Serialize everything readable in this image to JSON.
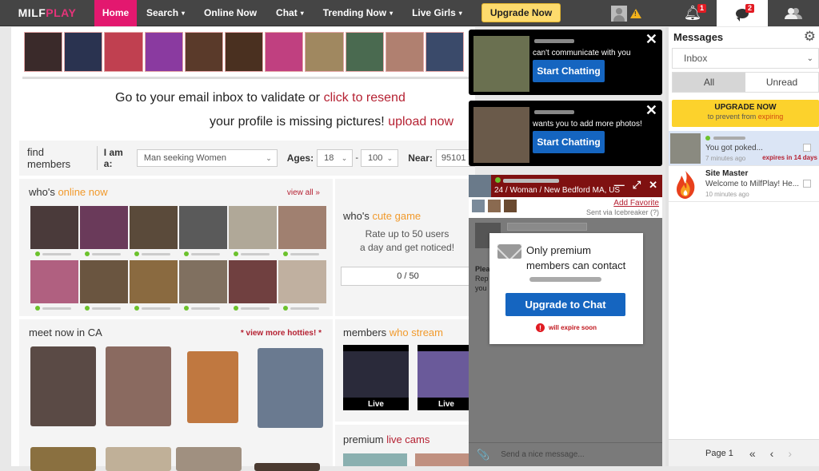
{
  "nav": {
    "logo_part1": "MILF",
    "logo_part2": "PLAY",
    "items": [
      {
        "label": "Home",
        "active": true,
        "dropdown": false
      },
      {
        "label": "Search",
        "dropdown": true
      },
      {
        "label": "Online Now",
        "dropdown": false
      },
      {
        "label": "Chat",
        "dropdown": true
      },
      {
        "label": "Trending Now",
        "dropdown": true
      },
      {
        "label": "Live Girls",
        "dropdown": true
      }
    ],
    "upgrade_label": "Upgrade Now",
    "warning_icon": "!",
    "notifications_count": "1",
    "messages_count": "2",
    "dropdown_caret": "▾"
  },
  "notices": {
    "validate_text": "Go to your email inbox to validate or ",
    "validate_link": "click to resend",
    "pictures_text": "your profile is missing pictures! ",
    "pictures_link": "upload now"
  },
  "search": {
    "title": "find members",
    "iam_label": "I am a:",
    "iam_value": "Man seeking Women",
    "ages_label": "Ages:",
    "age_min": "18",
    "age_sep": "-",
    "age_max": "100",
    "near_label": "Near:",
    "near_value": "95101",
    "chev": "⌄"
  },
  "online_now": {
    "title_prefix": "who's ",
    "title_highlight": "online now",
    "link": "view all »",
    "colors": [
      "#4a3a3a",
      "#6a3a5a",
      "#5a4a3a",
      "#5a5a5a",
      "#b0a898",
      "#a08070",
      "#b06080",
      "#6a5540",
      "#8a6a40",
      "#807060",
      "#704040",
      "#c0b0a0"
    ]
  },
  "cute_game": {
    "title_prefix": "who's ",
    "title_highlight": "cute game",
    "line1": "Rate up to 50 users",
    "line2": "a day and get noticed!",
    "count": "0 / 50"
  },
  "meet_now": {
    "title": "meet now in CA",
    "link": "* view more hotties! *"
  },
  "streams": {
    "title_prefix": "members ",
    "title_highlight": "who stream",
    "live_label": "Live"
  },
  "premium_cams": {
    "title_prefix": "premium ",
    "title_highlight": "live cams"
  },
  "toasts": [
    {
      "message": "can't communicate with you",
      "button": "Start Chatting",
      "close": "✕"
    },
    {
      "message": "wants you to add more photos!",
      "button": "Start Chatting",
      "close": "✕"
    }
  ],
  "chat_window": {
    "info": "24 / Woman / New Bedford MA, US",
    "minimize": "—",
    "expand": "⤢",
    "close": "✕",
    "add_favorite": "Add Favorite",
    "sent_via": "Sent via Icebreaker (?)",
    "hidden_text_1": "Plea",
    "hidden_text_2": "Rep",
    "hidden_text_3": "you",
    "input_placeholder": "Send a nice message...",
    "paperclip_icon": "📎"
  },
  "premium_modal": {
    "line1": "Only premium",
    "line2": "members can contact",
    "button": "Upgrade to Chat",
    "expire_icon": "!",
    "expire_text": "will expire soon"
  },
  "messages": {
    "title": "Messages",
    "gear_icon": "⚙",
    "folder": "Inbox",
    "tabs": [
      {
        "label": "All",
        "active": true
      },
      {
        "label": "Unread",
        "active": false
      }
    ],
    "upgrade_title": "UPGRADE NOW",
    "upgrade_sub_prefix": "to prevent from ",
    "upgrade_sub_highlight": "expiring",
    "items": [
      {
        "preview": "You got poked...",
        "time": "7 minutes ago",
        "expires": "expires in 14 days",
        "online": true,
        "selected": true
      },
      {
        "sender": "Site Master",
        "preview": "Welcome to MilfPlay! He...",
        "time": "10 minutes ago"
      }
    ],
    "page_label": "Page 1",
    "first_icon": "«",
    "prev_icon": "‹",
    "next_icon": "›"
  }
}
